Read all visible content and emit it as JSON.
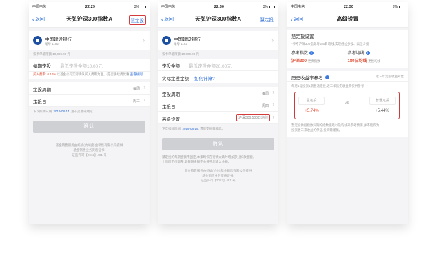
{
  "status_bar": {
    "carrier": "中国电信",
    "battery": "3%",
    "times": [
      "22:29",
      "22:30",
      "22:30"
    ]
  },
  "common": {
    "back_label": "返回",
    "bank_name": "中国建设银行",
    "bank_tail": "尾号 1182",
    "limit_note": "该卡单笔限额 10,000.00 元",
    "period_label": "定投周期",
    "period_value": "每周",
    "day_label": "定投日",
    "day_value": "周三",
    "confirm_button": "确认",
    "footer_line1": "基金销售服务由蚂蚁(杭州)基金销售有限公司提供",
    "footer_line2": "基金销售业务资格证书:",
    "footer_line3": "证监许可【2012】481 号"
  },
  "screen1": {
    "title": "天弘沪深300指数A",
    "smart_link": "慧定投",
    "amount_label": "每期定投",
    "amount_placeholder": "最低定投金额10.00元",
    "fee_text": "买入费率: 0.10%",
    "fee_rest": "以基金公司实际确认买入费用为准。(是否手续费优惠",
    "fee_link": "查看规则",
    "next_hint_prefix": "下次扣款日期:",
    "next_date": "2019-08-14,",
    "next_hint_suffix": "遇非交易日顺延"
  },
  "screen2": {
    "title": "天弘沪深300指数A",
    "smart_link": "慧定投",
    "amount_label": "定投金额",
    "amount_placeholder": "最低定投金额20.00元",
    "actual_label": "实际定投金额",
    "actual_link": "如何计算?",
    "period_value": "每周",
    "day_value": "周四",
    "advanced_label": "高级设置",
    "advanced_value": "沪深300,500日均线",
    "next_hint_prefix": "下次扣款时间:",
    "next_date": "2019-08-15,",
    "next_hint_suffix": "遇非交易日顺延。",
    "footnote1": "慧定投的每期金额不固定,本策略仅在行情大跌时增加部分扣款金额,",
    "footnote2": "上涨时不作调整,即每期金额不会低于您输入金额。"
  },
  "screen3": {
    "title": "高级设置",
    "smart_header": "慧定投设置",
    "smart_desc": "*参考沪深300指数与180日均线,实现低位多投、高位少投",
    "index_label": "参考指数",
    "index_value": "沪深300",
    "index_change": "更换指数",
    "ma_label": "参考均线",
    "ma_value": "180日均线",
    "ma_change": "更换均线",
    "history_title": "历史收益率参考",
    "history_sub": "近三年定投收益对比",
    "history_note": "每月1号投资1期普通定投,近三年历史收益率仅供参考",
    "smart_pill": "慧定投",
    "vs": "VS",
    "normal_pill": "普通定投",
    "smart_return": "+5.74%",
    "normal_return": "+5.44%",
    "footnote1": "慧定投依据指数同期的指数涨跌以及均线来参考预测,并不能作为",
    "footnote2": "投资者未来收益的保证,投资需谨慎。"
  },
  "colors": {
    "accent": "#2f6fd6",
    "highlight_border": "#d63b3b",
    "gain": "#e0523a"
  }
}
